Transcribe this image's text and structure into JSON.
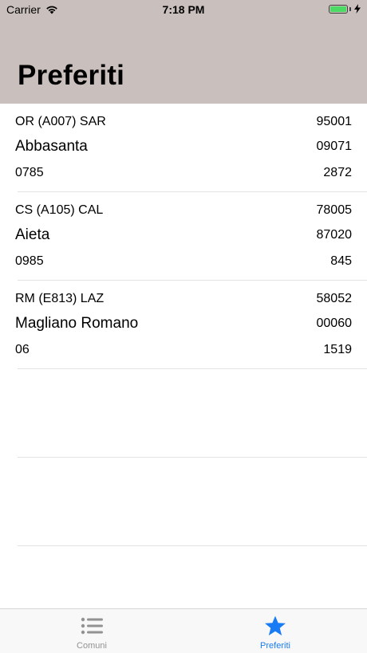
{
  "status_bar": {
    "carrier": "Carrier",
    "time": "7:18 PM"
  },
  "header": {
    "title": "Preferiti"
  },
  "favorites": [
    {
      "code": "OR (A007) SAR",
      "number": "95001",
      "name": "Abbasanta",
      "cap": "09071",
      "prefix": "0785",
      "population": "2872"
    },
    {
      "code": "CS (A105) CAL",
      "number": "78005",
      "name": "Aieta",
      "cap": "87020",
      "prefix": "0985",
      "population": "845"
    },
    {
      "code": "RM (E813) LAZ",
      "number": "58052",
      "name": "Magliano Romano",
      "cap": "00060",
      "prefix": "06",
      "population": "1519"
    }
  ],
  "tabbar": {
    "tabs": [
      {
        "label": "Comuni",
        "icon": "list-icon",
        "selected": false
      },
      {
        "label": "Preferiti",
        "icon": "star-icon",
        "selected": true
      }
    ]
  },
  "colors": {
    "header_bg": "#c9c0bd",
    "accent": "#1a7cf5",
    "inactive": "#929292",
    "battery": "#4cd964"
  }
}
